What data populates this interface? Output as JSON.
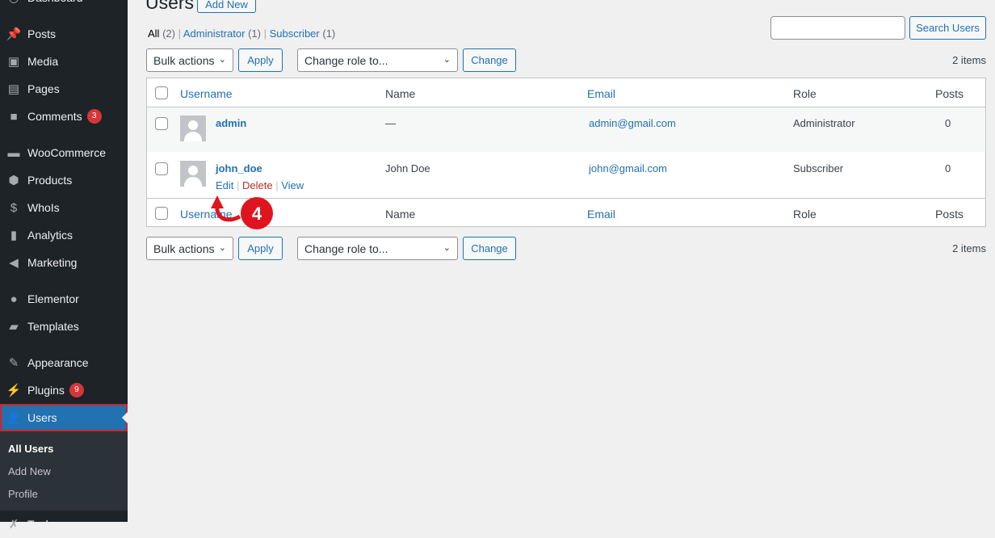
{
  "sidebar": {
    "items": [
      {
        "label": "Dashboard",
        "icon": "dashboard-icon"
      },
      {
        "label": "Posts",
        "icon": "pin-icon"
      },
      {
        "label": "Media",
        "icon": "media-icon"
      },
      {
        "label": "Pages",
        "icon": "pages-icon"
      },
      {
        "label": "Comments",
        "icon": "comment-icon",
        "badge": "3"
      },
      {
        "label": "WooCommerce",
        "icon": "woo-icon"
      },
      {
        "label": "Products",
        "icon": "box-icon"
      },
      {
        "label": "WhoIs",
        "icon": "dollar-icon"
      },
      {
        "label": "Analytics",
        "icon": "bar-chart-icon"
      },
      {
        "label": "Marketing",
        "icon": "megaphone-icon"
      },
      {
        "label": "Elementor",
        "icon": "elementor-icon"
      },
      {
        "label": "Templates",
        "icon": "folder-icon"
      },
      {
        "label": "Appearance",
        "icon": "brush-icon"
      },
      {
        "label": "Plugins",
        "icon": "plug-icon",
        "badge": "9"
      },
      {
        "label": "Users",
        "icon": "user-icon",
        "active": true
      },
      {
        "label": "Tools",
        "icon": "wrench-icon"
      }
    ],
    "submenu": [
      "All Users",
      "Add New",
      "Profile"
    ]
  },
  "page": {
    "title": "Users",
    "add_new": "Add New"
  },
  "filters": {
    "all": "All",
    "all_count": "(2)",
    "admin": "Administrator",
    "admin_count": "(1)",
    "sub": "Subscriber",
    "sub_count": "(1)"
  },
  "search": {
    "value": "",
    "button": "Search Users"
  },
  "toolbar": {
    "bulk": "Bulk actions",
    "apply": "Apply",
    "role": "Change role to...",
    "change": "Change",
    "items": "2 items"
  },
  "table": {
    "columns": [
      "Username",
      "Name",
      "Email",
      "Role",
      "Posts"
    ],
    "rows": [
      {
        "username": "admin",
        "name": "—",
        "email": "admin@gmail.com",
        "role": "Administrator",
        "posts": "0"
      },
      {
        "username": "john_doe",
        "name": "John Doe",
        "email": "john@gmail.com",
        "role": "Subscriber",
        "posts": "0",
        "actions": [
          "Edit",
          "Delete",
          "View"
        ]
      }
    ]
  },
  "annotation": {
    "step": "4",
    "color": "#e0141e"
  }
}
